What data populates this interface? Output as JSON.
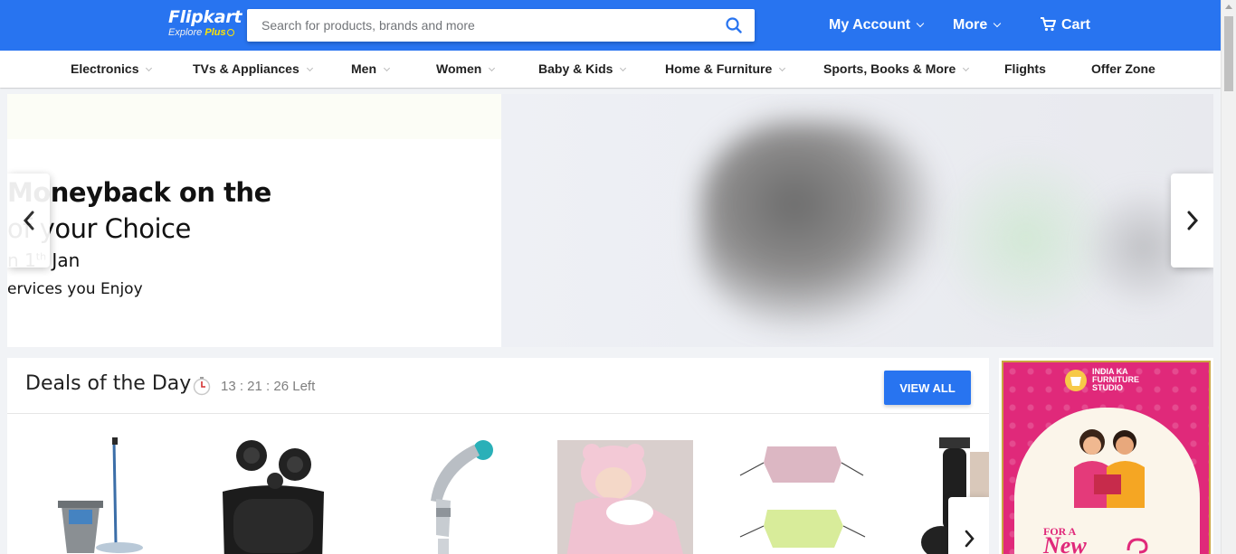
{
  "header": {
    "logo": {
      "brand": "Flipkart",
      "tagline": "Explore",
      "plus": "Plus"
    },
    "search": {
      "placeholder": "Search for products, brands and more",
      "icon": "search-icon"
    },
    "nav": [
      {
        "label": "My Account",
        "icon": "chevron-down-icon"
      },
      {
        "label": "More",
        "icon": "chevron-down-icon"
      },
      {
        "label": "Cart",
        "icon": "cart-icon"
      }
    ]
  },
  "categories": [
    {
      "label": "Electronics",
      "dropdown": true
    },
    {
      "label": "TVs & Appliances",
      "dropdown": true
    },
    {
      "label": "Men",
      "dropdown": true
    },
    {
      "label": "Women",
      "dropdown": true
    },
    {
      "label": "Baby & Kids",
      "dropdown": true
    },
    {
      "label": "Home & Furniture",
      "dropdown": true
    },
    {
      "label": "Sports, Books & More",
      "dropdown": true
    },
    {
      "label": "Flights",
      "dropdown": false
    },
    {
      "label": "Offer Zone",
      "dropdown": false
    }
  ],
  "banner": {
    "line1": "Moneyback on the",
    "line2": "of your Choice",
    "line3_prefix": "n 1",
    "line3_sup": "th",
    "line3_suffix": "Jan",
    "line4": "ervices you Enjoy"
  },
  "deals": {
    "title": "Deals of the Day",
    "timer": "13 : 21 : 26 Left",
    "view_all": "VIEW ALL",
    "products": [
      {
        "name": "spin-mop"
      },
      {
        "name": "wireless-earbuds"
      },
      {
        "name": "health-faucet"
      },
      {
        "name": "baby-wrap"
      },
      {
        "name": "face-masks"
      },
      {
        "name": "trimmer"
      }
    ]
  },
  "ad": {
    "line1": "INDIA KA",
    "line2": "FURNITURE",
    "line3": "STUDIO",
    "for_a": "FOR A",
    "new": "New"
  },
  "colors": {
    "primary": "#2874f0",
    "accent": "#ffe500",
    "ad_pink": "#e0297a"
  }
}
